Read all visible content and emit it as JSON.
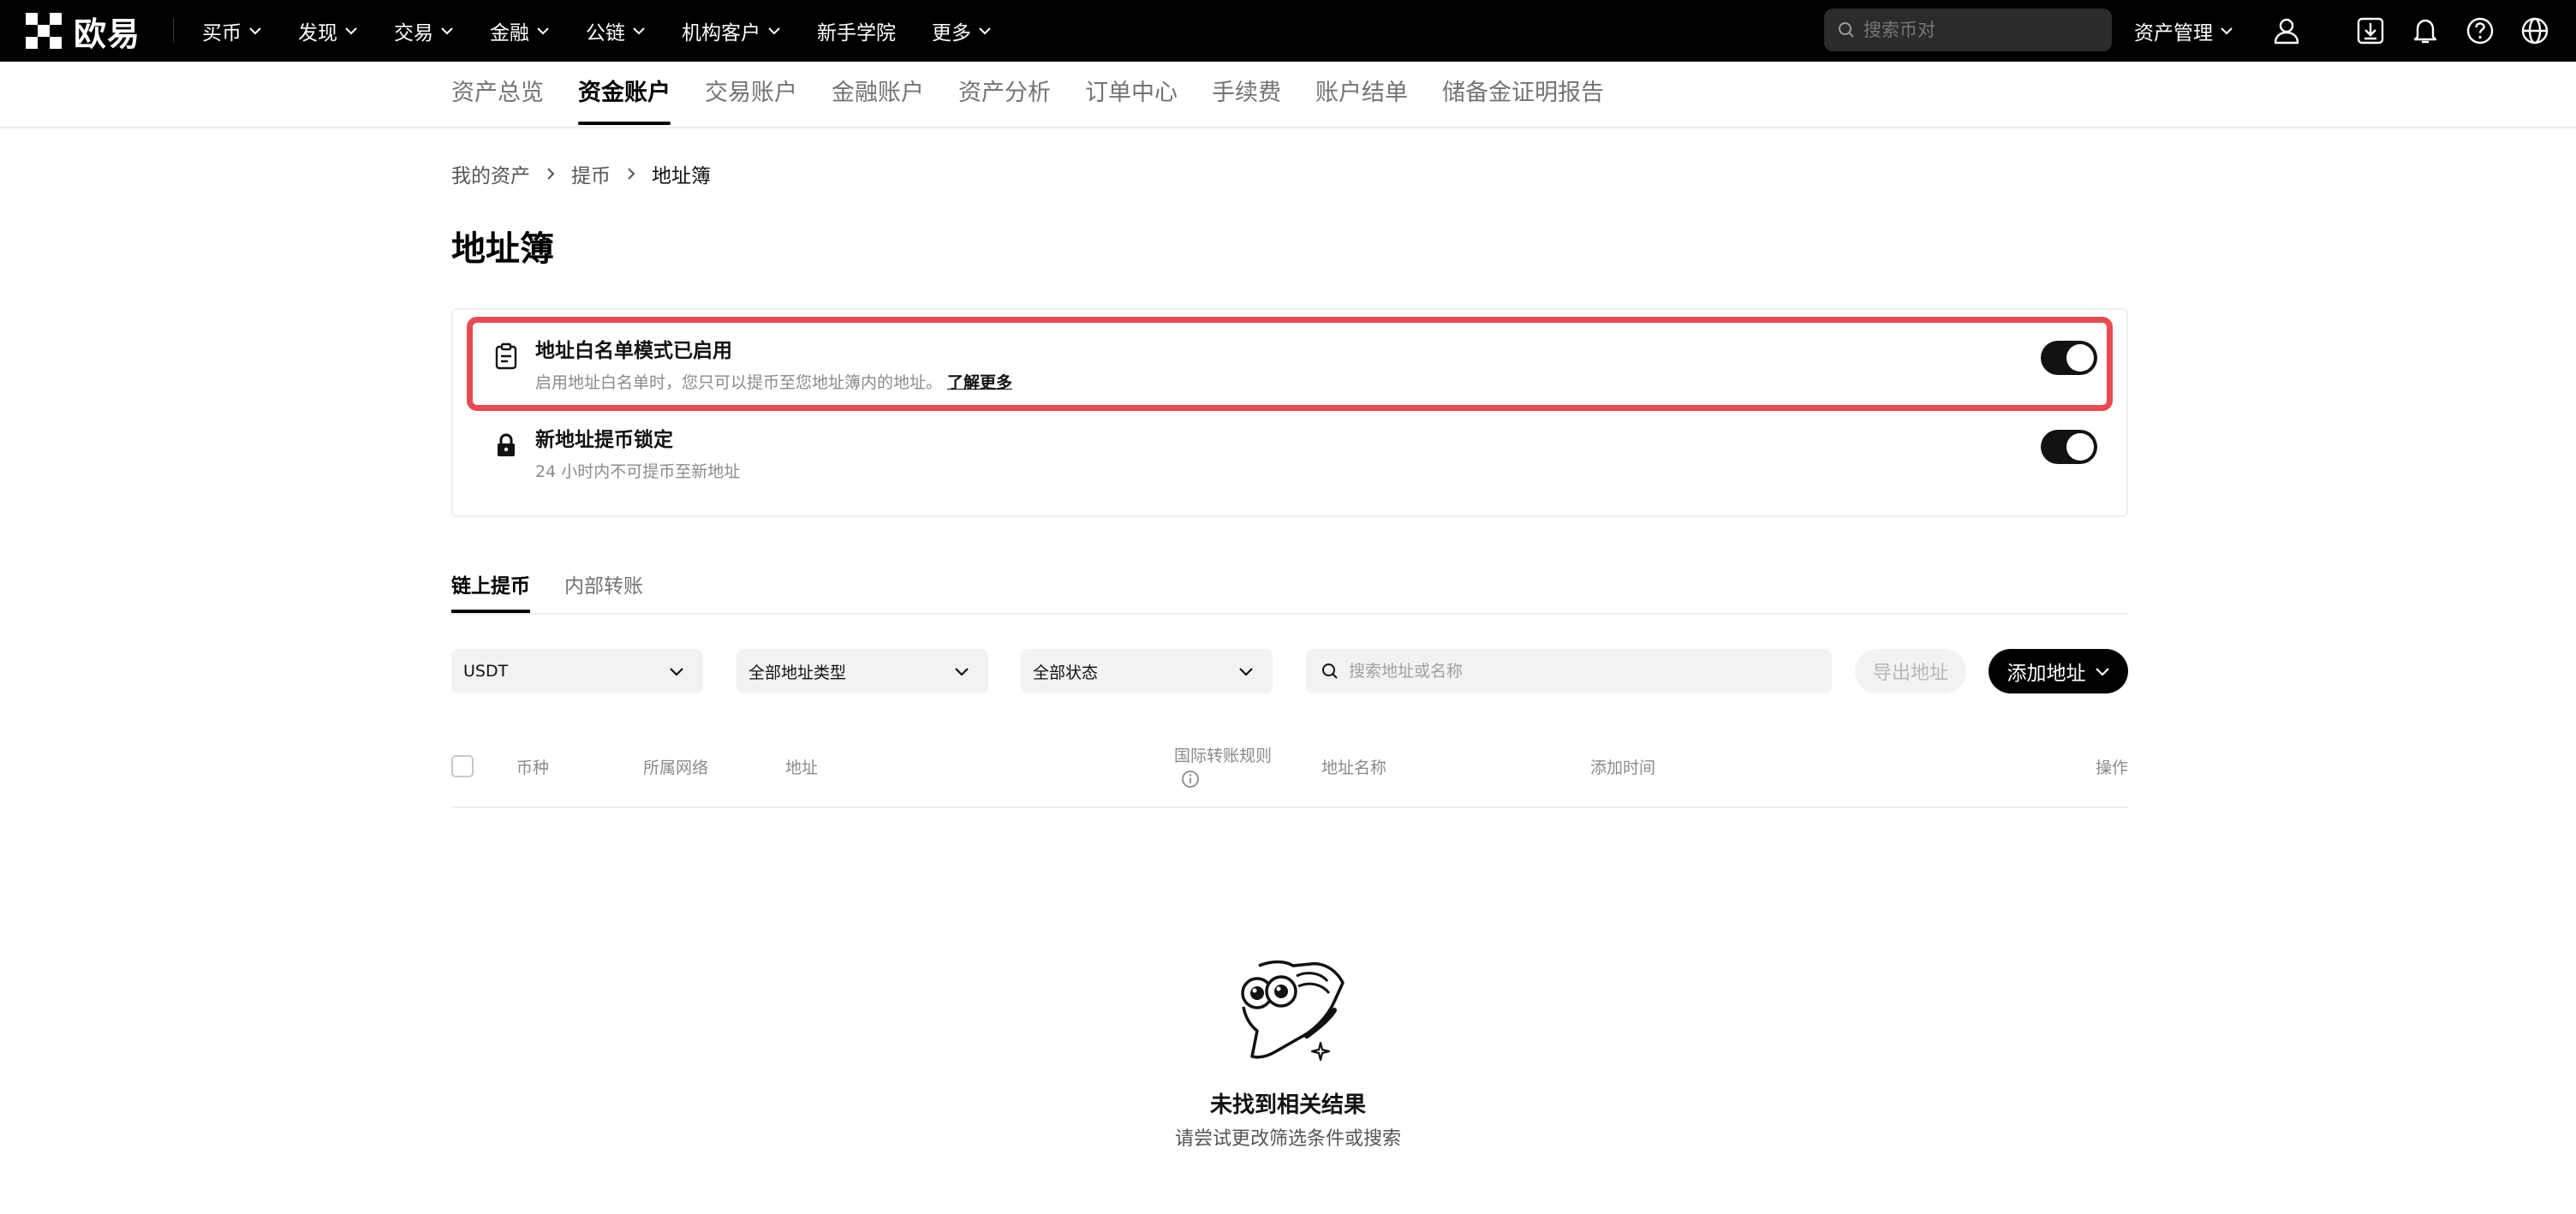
{
  "topnav": {
    "logo_text": "欧易",
    "items": [
      {
        "label": "买币",
        "has_dropdown": true
      },
      {
        "label": "发现",
        "has_dropdown": true
      },
      {
        "label": "交易",
        "has_dropdown": true
      },
      {
        "label": "金融",
        "has_dropdown": true
      },
      {
        "label": "公链",
        "has_dropdown": true
      },
      {
        "label": "机构客户",
        "has_dropdown": true
      },
      {
        "label": "新手学院",
        "has_dropdown": false
      },
      {
        "label": "更多",
        "has_dropdown": true
      }
    ],
    "search_placeholder": "搜索币对",
    "asset_management": "资产管理",
    "icons": [
      "user-icon",
      "download-icon",
      "bell-icon",
      "help-icon",
      "globe-icon"
    ]
  },
  "subnav": {
    "items": [
      "资产总览",
      "资金账户",
      "交易账户",
      "金融账户",
      "资产分析",
      "订单中心",
      "手续费",
      "账户结单",
      "储备金证明报告"
    ],
    "active_index": 1
  },
  "breadcrumb": {
    "items": [
      "我的资产",
      "提币",
      "地址簿"
    ]
  },
  "page_title": "地址簿",
  "settings": {
    "whitelist": {
      "title": "地址白名单模式已启用",
      "desc": "启用地址白名单时，您只可以提币至您地址簿内的地址。",
      "link": "了解更多",
      "enabled": true,
      "icon": "clipboard-icon"
    },
    "new_address_lock": {
      "title": "新地址提币锁定",
      "desc": "24 小时内不可提币至新地址",
      "enabled": true,
      "icon": "lock-icon"
    },
    "highlight_color": "#e84a4f"
  },
  "tabs": {
    "items": [
      "链上提币",
      "内部转账"
    ],
    "active_index": 0
  },
  "filters": {
    "currency": "USDT",
    "address_type": "全部地址类型",
    "status": "全部状态",
    "search_placeholder": "搜索地址或名称",
    "export_label": "导出地址",
    "add_label": "添加地址"
  },
  "table": {
    "columns": [
      "币种",
      "所属网络",
      "地址",
      "国际转账规则",
      "地址名称",
      "添加时间",
      "操作"
    ]
  },
  "empty_state": {
    "title": "未找到相关结果",
    "subtitle": "请尝试更改筛选条件或搜索"
  }
}
